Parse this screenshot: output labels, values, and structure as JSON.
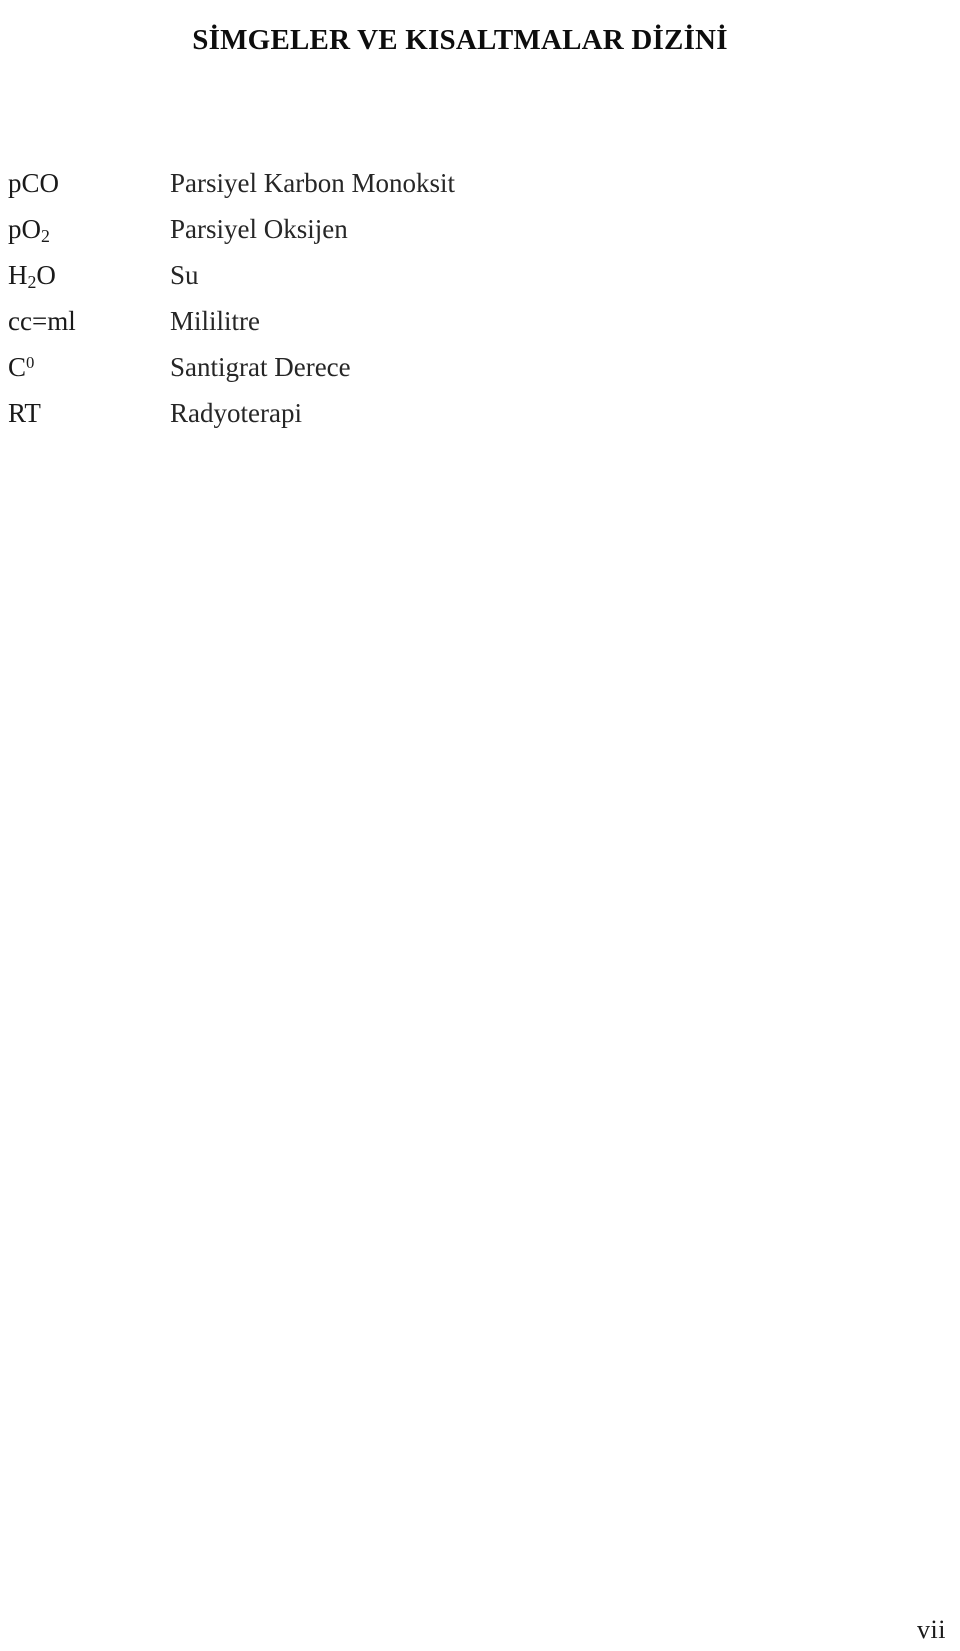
{
  "document": {
    "title": "SİMGELER VE KISALTMALAR DİZİNİ",
    "page_number": "vii"
  },
  "abbreviations": {
    "entries": [
      {
        "symbol_html": "pCO",
        "symbol_text": "pCO",
        "meaning": "Parsiyel Karbon Monoksit"
      },
      {
        "symbol_html": "pO<sub>2</sub>",
        "symbol_text": "pO2",
        "meaning": "Parsiyel Oksijen"
      },
      {
        "symbol_html": "H<sub>2</sub>O",
        "symbol_text": "H2O",
        "meaning": "Su"
      },
      {
        "symbol_html": "cc=ml",
        "symbol_text": "cc=ml",
        "meaning": "Mililitre"
      },
      {
        "symbol_html": "C<sup>0</sup>",
        "symbol_text": "C0",
        "meaning": "Santigrat Derece"
      },
      {
        "symbol_html": "RT",
        "symbol_text": "RT",
        "meaning": "Radyoterapi"
      }
    ]
  },
  "colors": {
    "page_background": "#ffffff",
    "title_text": "#0d0d0d",
    "symbol_text": "#1a1a1a",
    "meaning_text": "#262626"
  }
}
